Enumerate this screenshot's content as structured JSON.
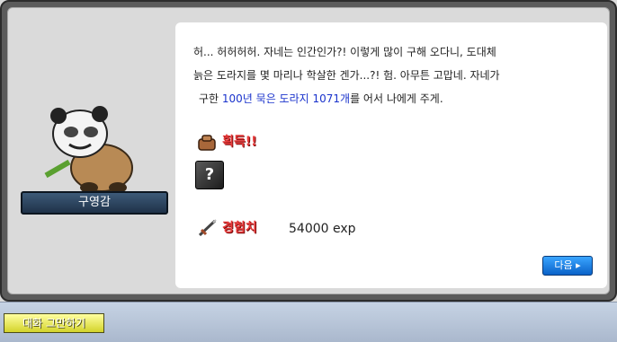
{
  "npc": {
    "name": "구영감",
    "portrait_icon": "panda-npc-icon"
  },
  "dialog": {
    "line1": "허... 허허허허. 자네는 인간인가?! 이렇게 많이 구해 오다니, 도대체",
    "line2": "늙은 도라지를 몇 마리나 학살한 겐가...?! 험. 아무튼 고맙네. 자네가",
    "line3_prefix": "구한 ",
    "line3_highlight": "100년 묵은 도라지 1071개",
    "line3_suffix": "를 어서 나에게 주게."
  },
  "reward": {
    "obtain_label": "획득!!",
    "obtain_icon": "bag-icon",
    "item_icon": "unknown-item-icon",
    "item_glyph": "?",
    "exp_label": "경험치",
    "exp_icon": "sword-icon",
    "exp_value": "54000 exp"
  },
  "buttons": {
    "next": "다음 ▸",
    "end_chat": "대화 그만하기"
  },
  "colors": {
    "highlight": "#1a33cc",
    "reward_label": "#e83a3a",
    "next_button": "#0a62c8",
    "end_chat_button": "#d3d32a"
  }
}
